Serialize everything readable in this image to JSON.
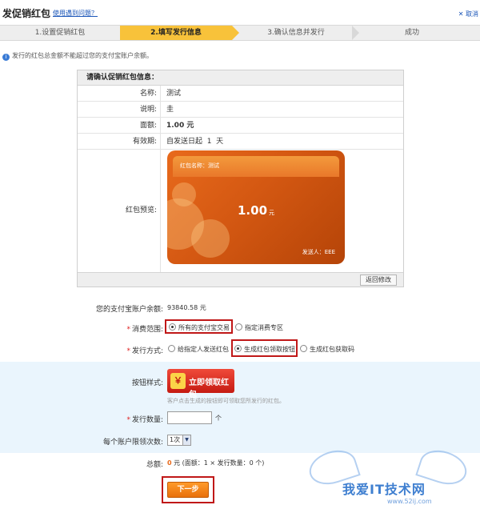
{
  "header": {
    "title": "发促销红包",
    "help_link": "使用遇到问题？",
    "close_label": "取消"
  },
  "steps": [
    "1.设置促销红包",
    "2.填写发行信息",
    "3.确认信息并发行",
    "成功"
  ],
  "notice": "发行的红包总金额不能超过您的支付宝账户余额。",
  "confirm": {
    "heading": "请确认促销红包信息：",
    "rows": [
      {
        "label": "名称:",
        "value": "测试"
      },
      {
        "label": "说明:",
        "value": "圭"
      },
      {
        "label": "面额:",
        "value": "1.00 元"
      },
      {
        "label": "有效期:",
        "value": "自发送日起  1  天"
      },
      {
        "label": "红包预览:",
        "value": ""
      }
    ],
    "card": {
      "name": "红包名称：测试",
      "amount": "1.00",
      "unit": "元",
      "sender": "发送人：EEE"
    },
    "back_button": "返回修改"
  },
  "form": {
    "balance_label": "您的支付宝账户余额:",
    "balance_value": "93840.58 元",
    "scope_label": "消费范围:",
    "scope_options": [
      "所有的支付宝交易",
      "指定消费专区"
    ],
    "method_label": "发行方式:",
    "method_options": [
      "给指定人发送红包",
      "生成红包领取按钮",
      "生成红包获取码"
    ],
    "style_label": "按钮样式:",
    "style_button": "立即领取红包",
    "style_icon": "￥",
    "style_hint": "客户点击生成的按钮即可领取您所发行的红包。",
    "qty_label": "发行数量:",
    "qty_value": "",
    "qty_unit": "个",
    "limit_label": "每个账户限领次数:",
    "limit_value": "1次",
    "total_label": "总额:",
    "total_value": "0",
    "total_detail": "元 (面额：1 × 发行数量：0 个)",
    "next_button": "下一步"
  },
  "watermark": {
    "text": "我爱IT技术网",
    "url": "www.52ij.com"
  },
  "colors": {
    "active_step": "#f8c23a",
    "highlight_box": "#c01818",
    "link": "#1a55b8",
    "card": "#d45812",
    "blue_zone": "#eaf5fd"
  }
}
